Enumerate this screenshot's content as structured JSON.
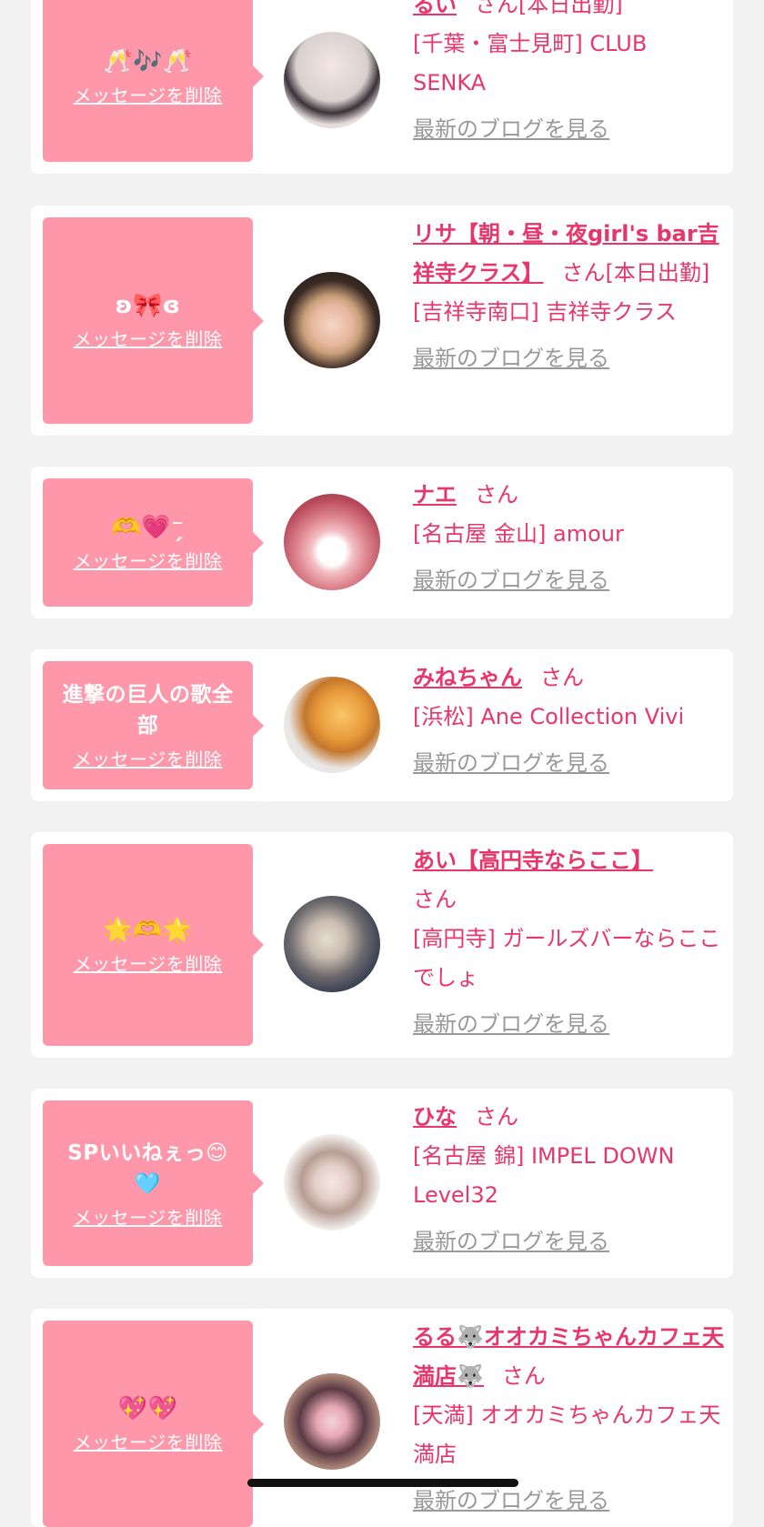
{
  "delete_label": "メッセージを削除",
  "san_suffix": "さん",
  "blog_label": "最新のブログを見る",
  "messages": [
    {
      "text": "🥂🎶🥂",
      "name": "るい",
      "status": "[本日出勤]",
      "shop": "[千葉・富士見町] CLUB SENKA"
    },
    {
      "text": "ʚ🎀ɞ",
      "name": "リサ【朝・昼・夜girl's bar吉祥寺クラス】",
      "status": "[本日出勤]",
      "shop": "[吉祥寺南口] 吉祥寺クラス"
    },
    {
      "text": "🫶💗⁻̗",
      "name": "ナエ",
      "status": "",
      "shop": "[名古屋 金山] amour"
    },
    {
      "text": "進撃の巨人の歌全部",
      "name": "みねちゃん",
      "status": "",
      "shop": "[浜松] Ane Collection Vivi"
    },
    {
      "text": "🌟🫶🌟",
      "name": "あい【高円寺ならここ】",
      "status": "",
      "shop": "[高円寺] ガールズバーならここでしょ"
    },
    {
      "text": "SPいいねぇっ😊🩵",
      "name": "ひな",
      "status": "",
      "shop": "[名古屋 錦] IMPEL DOWN Level32"
    },
    {
      "text": "💖💖",
      "name": "るる🐺オオカミちゃんカフェ天満店🐺",
      "status": "",
      "shop": "[天満] オオカミちゃんカフェ天満店"
    }
  ]
}
